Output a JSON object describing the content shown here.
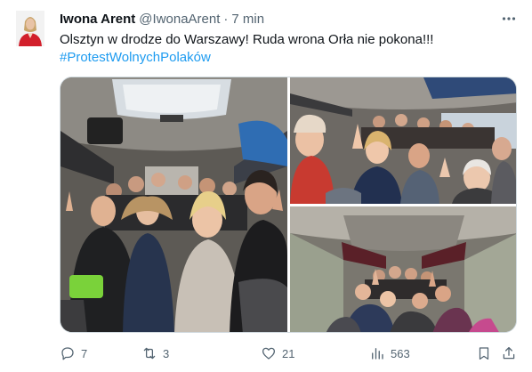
{
  "author": {
    "name": "Iwona Arent",
    "handle": "@IwonaArent",
    "separator": "·",
    "time": "7 min"
  },
  "tweet": {
    "text": "Olsztyn w drodze do Warszawy! Ruda wrona Orła nie pokona!!!",
    "hashtag": "#ProtestWolnychPolaków"
  },
  "media": {
    "photo_count": 3
  },
  "actions": {
    "replies": "7",
    "retweets": "3",
    "likes": "21",
    "views": "563"
  },
  "colors": {
    "text": "#0f1419",
    "secondary": "#536471",
    "link": "#1d9bf0",
    "border": "#cfd9de"
  },
  "icons": {
    "more": "more-dots-icon",
    "reply": "reply-icon",
    "retweet": "retweet-icon",
    "like": "heart-icon",
    "views": "views-chart-icon",
    "bookmark": "bookmark-icon",
    "share": "share-icon"
  }
}
